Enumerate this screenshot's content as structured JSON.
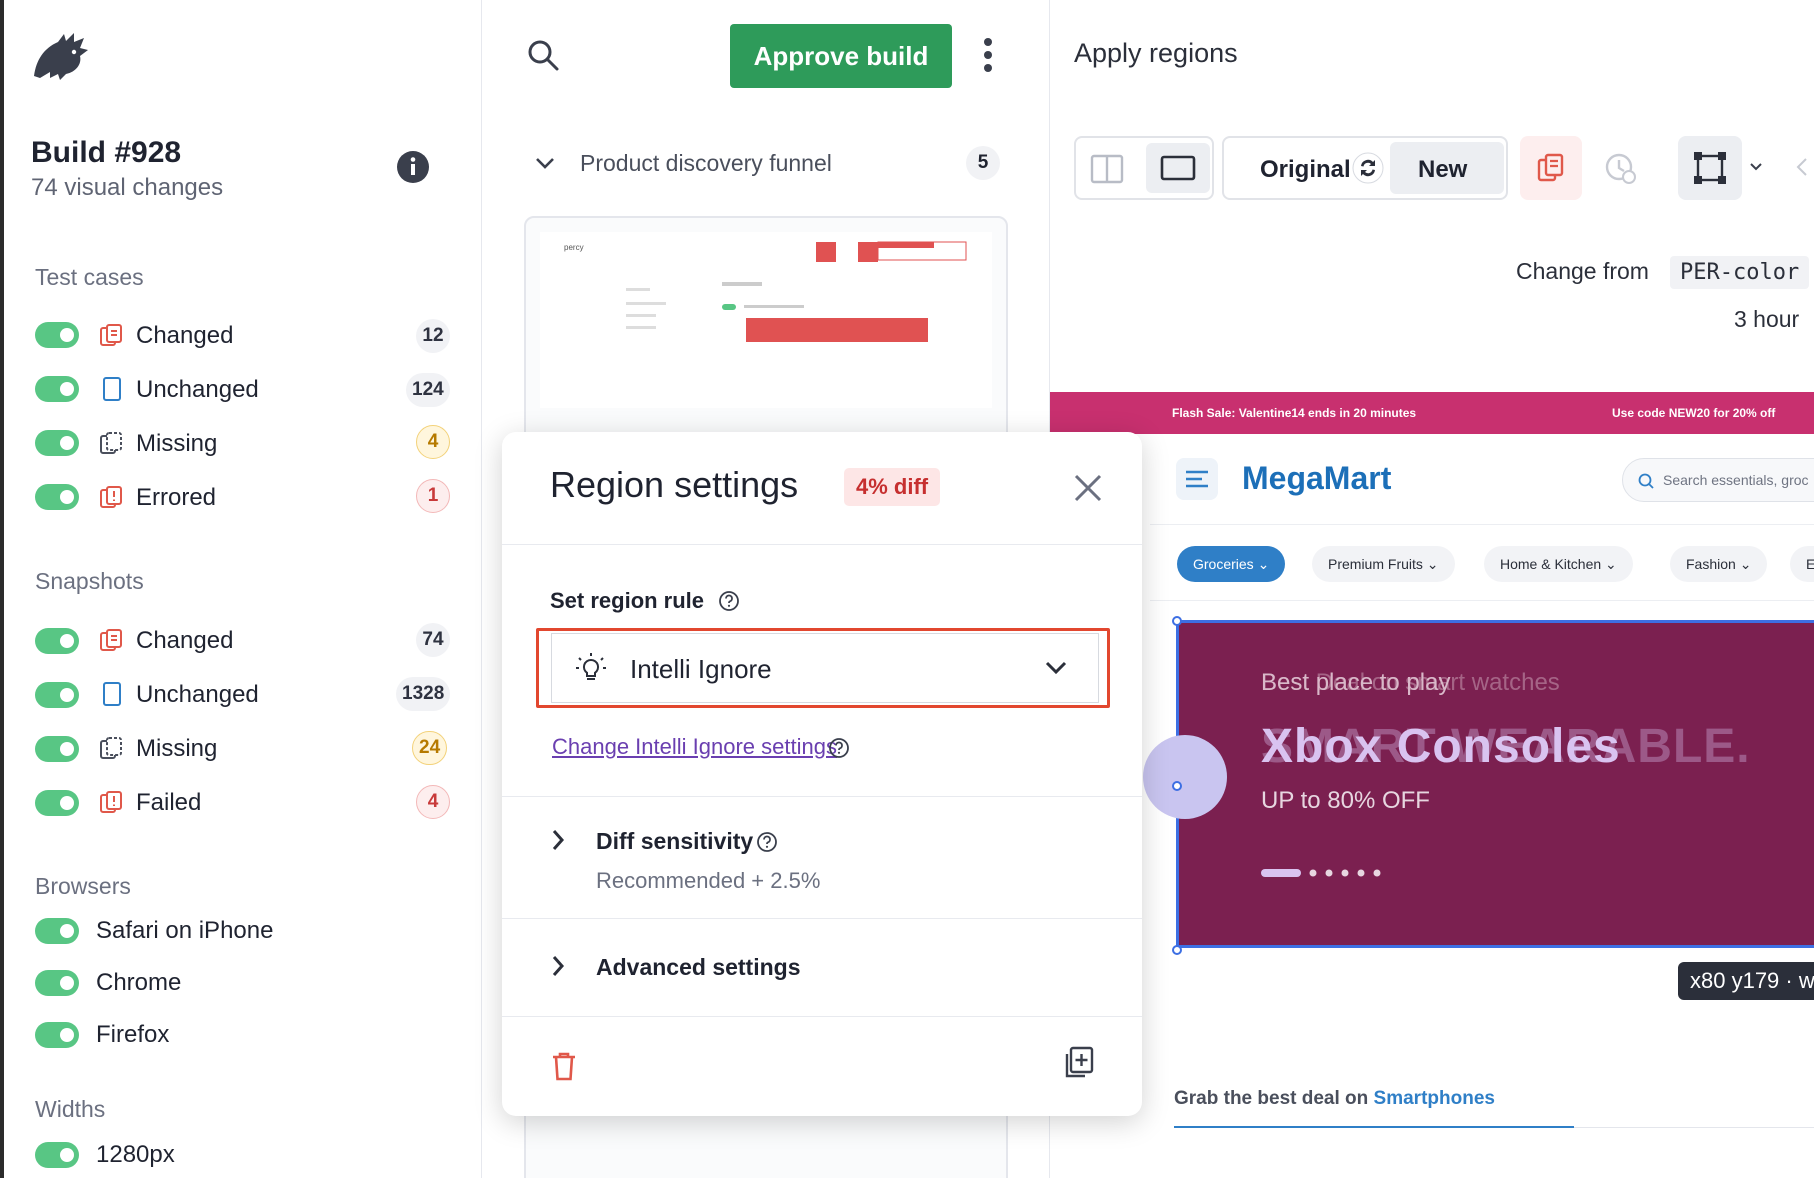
{
  "sidebar": {
    "build_title": "Build #928",
    "build_subtitle": "74 visual changes",
    "test_cases": {
      "heading": "Test cases",
      "items": [
        {
          "label": "Changed",
          "count": "12"
        },
        {
          "label": "Unchanged",
          "count": "124"
        },
        {
          "label": "Missing",
          "count": "4"
        },
        {
          "label": "Errored",
          "count": "1"
        }
      ]
    },
    "snapshots": {
      "heading": "Snapshots",
      "items": [
        {
          "label": "Changed",
          "count": "74"
        },
        {
          "label": "Unchanged",
          "count": "1328"
        },
        {
          "label": "Missing",
          "count": "24"
        },
        {
          "label": "Failed",
          "count": "4"
        }
      ]
    },
    "browsers": {
      "heading": "Browsers",
      "items": [
        "Safari on iPhone",
        "Chrome",
        "Firefox"
      ]
    },
    "widths": {
      "heading": "Widths",
      "items": [
        "1280px"
      ]
    }
  },
  "middle": {
    "approve_label": "Approve build",
    "group_label": "Product discovery funnel",
    "group_count": "5"
  },
  "right": {
    "title": "Apply regions",
    "original_label": "Original",
    "new_label": "New",
    "change_from_label": "Change from",
    "change_from_value": "PER-color",
    "time_ago": "3 hour"
  },
  "site": {
    "promo_left": "Flash Sale: Valentine14 ends in 20 minutes",
    "promo_right": "Use code  NEW20 for 20% off",
    "logo": "MegaMart",
    "search_placeholder": "Search essentials, groc",
    "categories": [
      "Groceries",
      "Premium Fruits",
      "Home & Kitchen",
      "Fashion",
      "Ele"
    ],
    "hero_subtitle": "Best place to play",
    "hero_subtitle_ghost": "Best Deal on smart watches",
    "hero_title": "Xbox Consoles",
    "hero_title_ghost": "SMART WEARABLE.",
    "hero_offer": "UP to 80% OFF",
    "coord_tag": "x80 y179 · w",
    "grab_prefix": "Grab the best deal on ",
    "grab_highlight": "Smartphones"
  },
  "modal": {
    "title": "Region settings",
    "diff_badge": "4% diff",
    "rule_label": "Set region rule",
    "rule_value": "Intelli Ignore",
    "settings_link": "Change Intelli Ignore settings",
    "sensitivity_title": "Diff sensitivity",
    "sensitivity_sub": "Recommended + 2.5%",
    "advanced_title": "Advanced settings"
  },
  "colors": {
    "toggle_green": "#58c684",
    "approve_green": "#2e9b5a",
    "promo_pink": "#c8306f",
    "hero_bg": "#7b2050",
    "region_border": "#3d6fe3",
    "select_highlight": "#e2472f",
    "link_purple": "#6a3fb0"
  }
}
